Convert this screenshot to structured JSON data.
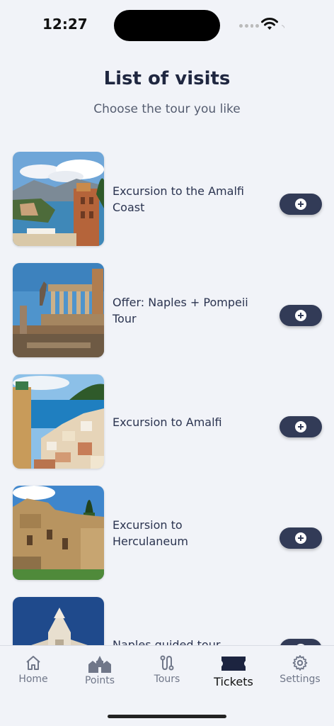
{
  "status_bar": {
    "time": "12:27"
  },
  "header": {
    "title": "List of visits",
    "subtitle": "Choose the tour you like"
  },
  "tours": [
    {
      "title": "Excursion to the Amalfi Coast",
      "image": "sorrento-coast-photo"
    },
    {
      "title": "Offer: Naples + Pompeii Tour",
      "image": "pompeii-ruins-photo"
    },
    {
      "title": "Excursion to Amalfi",
      "image": "amalfi-town-photo"
    },
    {
      "title": "Excursion to Herculaneum",
      "image": "herculaneum-ruins-photo"
    },
    {
      "title": "Naples guided tour",
      "image": "naples-cathedral-photo"
    }
  ],
  "tab_bar": {
    "tabs": [
      {
        "label": "Home",
        "icon": "home-icon"
      },
      {
        "label": "Points",
        "icon": "points-icon"
      },
      {
        "label": "Tours",
        "icon": "route-icon"
      },
      {
        "label": "Tickets",
        "icon": "ticket-icon"
      },
      {
        "label": "Settings",
        "icon": "gear-icon"
      }
    ],
    "active": "Tickets"
  },
  "colors": {
    "background": "#f1f3f8",
    "accent": "#323b57",
    "title_text": "#1f2740",
    "tab_inactive": "#707789"
  }
}
